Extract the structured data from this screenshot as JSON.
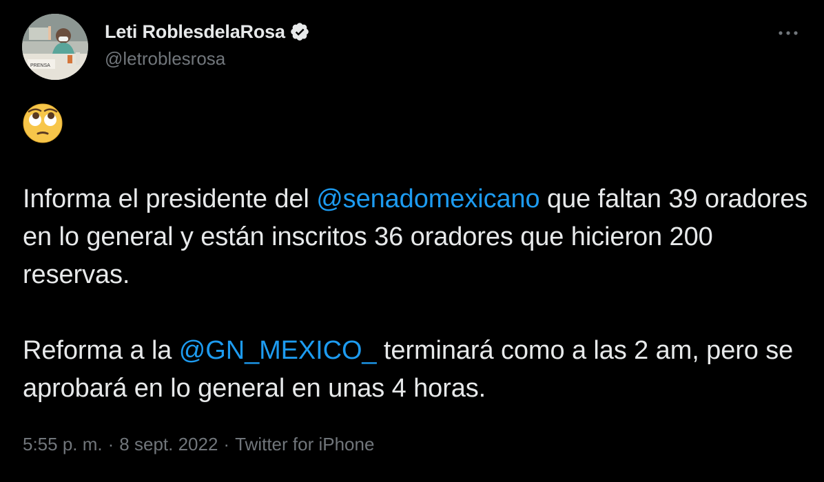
{
  "tweet": {
    "author": {
      "display_name": "Leti RoblesdelaRosa",
      "handle": "@letroblesrosa",
      "verified": true,
      "avatar_caption": "PRENSA"
    },
    "emoji": "face-with-rolling-eyes",
    "paragraph1": {
      "text_before": "Informa el presidente del ",
      "mention": "@senadomexicano",
      "text_after": " que faltan 39 oradores en lo general y están inscritos 36 oradores que hicieron 200 reservas."
    },
    "paragraph2": {
      "text_before": "Reforma a la ",
      "mention": "@GN_MEXICO_",
      "text_after": " terminará como a las 2 am, pero se aprobará en lo general en unas 4 horas."
    },
    "meta": {
      "time": "5:55 p. m.",
      "separator": "·",
      "date": "8 sept. 2022",
      "source": "Twitter for iPhone"
    }
  },
  "colors": {
    "background": "#000000",
    "text": "#e7e9ea",
    "secondary": "#71767b",
    "link": "#1d9bf0",
    "verified_badge": "#e7e9ea"
  },
  "icons": {
    "more": "more-horizontal-icon",
    "verified": "verified-badge-icon"
  }
}
